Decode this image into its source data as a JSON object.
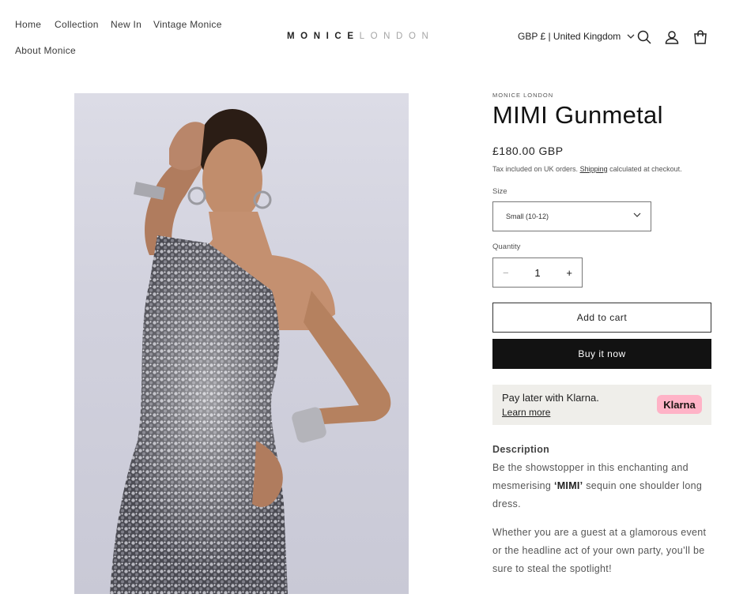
{
  "header": {
    "nav": [
      "Home",
      "Collection",
      "New In",
      "Vintage Monice",
      "About Monice"
    ],
    "logo_dark": "MONICE",
    "logo_light": "LONDON",
    "locale": "GBP £ | United Kingdom"
  },
  "icons": [
    "search-icon",
    "account-icon",
    "cart-icon",
    "chevron-down-icon"
  ],
  "product": {
    "vendor": "MONICE LONDON",
    "title": "MIMI Gunmetal",
    "price": "£180.00 GBP",
    "tax_prefix": "Tax included on UK orders.",
    "tax_link": "Shipping",
    "tax_suffix": "calculated at checkout.",
    "size_label": "Size",
    "size_value": "Small (10-12)",
    "quantity_label": "Quantity",
    "quantity_value": "1",
    "minus": "−",
    "plus": "+",
    "add_to_cart": "Add to cart",
    "buy_now": "Buy it now"
  },
  "klarna": {
    "text": "Pay later with Klarna.",
    "link": "Learn more",
    "badge": "Klarna"
  },
  "description": {
    "heading": "Description",
    "p1_start": "Be the showstopper in this enchanting and mesmerising ",
    "p1_bold": "‘MIMI’",
    "p1_end": " sequin one shoulder long dress.",
    "p2": "Whether you are a guest at a glamorous event or the headline act of your own party, you’ll be sure to steal the spotlight!"
  },
  "colors": {
    "text": "#121212",
    "button_dark": "#121212",
    "klarna_bg": "#efeeea",
    "klarna_pink": "#ffb3c7"
  }
}
